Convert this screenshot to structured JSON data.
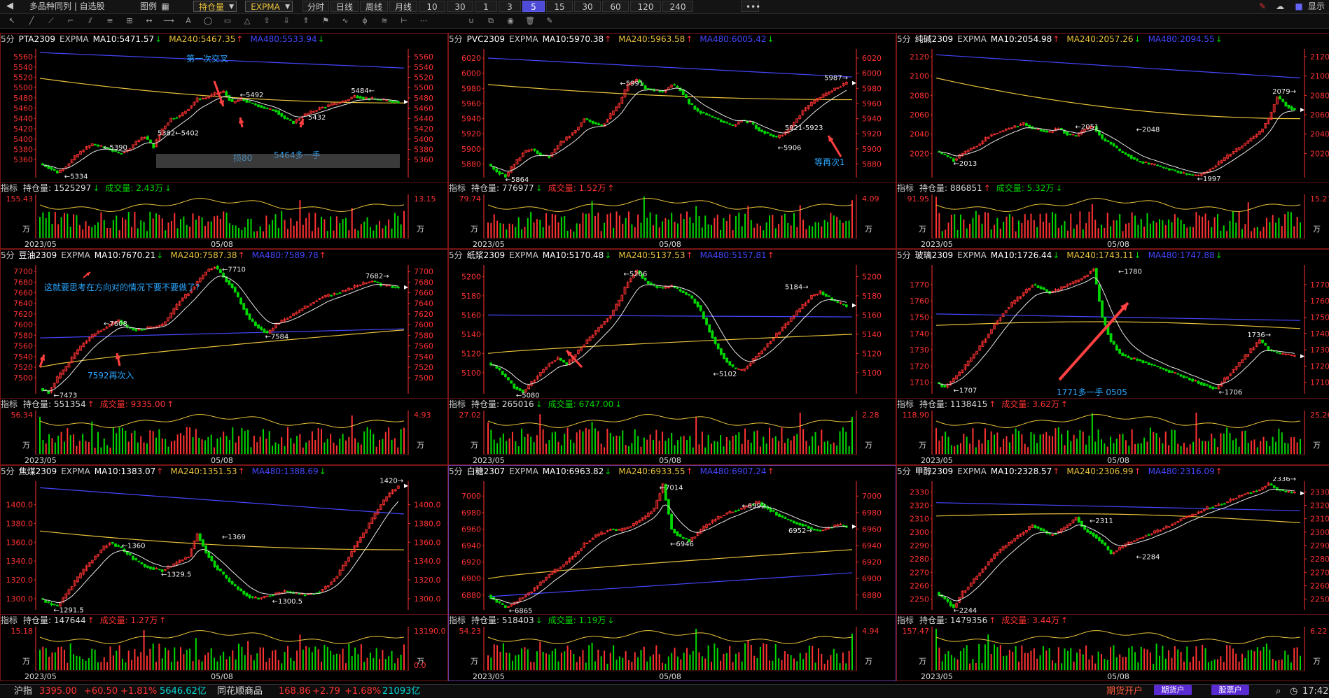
{
  "colors": {
    "up": "#ff3232",
    "down": "#00d700",
    "ma10": "#e8e8e8",
    "ma240": "#e8c23a",
    "ma480": "#4646ff",
    "volLine": "#e8c23a",
    "axis": "#ff3232"
  },
  "toolbar": {
    "back_icon": "back-icon",
    "title": "多品种同列 | 自选股",
    "legend_label": "图例",
    "position_select": "持仓量",
    "indicator_select": "EXPMA",
    "periods": [
      "分时",
      "日线",
      "周线",
      "月线",
      "10秒",
      "30秒",
      "1分",
      "3分",
      "5分",
      "15分",
      "30分",
      "60分",
      "120分",
      "240分"
    ],
    "active_period": "5分",
    "more_label": "•••",
    "right_label": "显示"
  },
  "panels": [
    {
      "id": "pta",
      "header": {
        "period": "5分",
        "name": "PTA2309",
        "ind": "EXPMA",
        "ma10": "MA10:5471.57",
        "ma10_dir": "↓",
        "ma240": "MA240:5467.35",
        "ma240_dir": "↑",
        "ma480": "MA480:5533.94",
        "ma480_dir": "↓"
      },
      "yTicks": [
        "5560",
        "5540",
        "5520",
        "5500",
        "5480",
        "5460",
        "5440",
        "5420",
        "5400",
        "5380",
        "5360"
      ],
      "yMin": 5325,
      "yMax": 5575,
      "ma480": [
        5568,
        5538
      ],
      "ma240": [
        5518,
        5470
      ],
      "ma240Shape": "flat",
      "priceMarks": [
        {
          "label": "←5334",
          "t": 0.06,
          "v": 5334
        },
        {
          "label": "←5390",
          "t": 0.17,
          "v": 5390
        },
        {
          "label": "5382←5402",
          "t": 0.32,
          "v": 5402
        },
        {
          "label": "←5492",
          "t": 0.55,
          "v": 5492
        },
        {
          "label": "5432",
          "t": 0.74,
          "v": 5432
        },
        {
          "label": "5484←",
          "t": 0.86,
          "v": 5484
        }
      ],
      "path": [
        5352,
        5345,
        5335,
        5348,
        5365,
        5380,
        5390,
        5385,
        5380,
        5372,
        5378,
        5395,
        5405,
        5385,
        5420,
        5440,
        5445,
        5460,
        5478,
        5480,
        5488,
        5492,
        5470,
        5478,
        5470,
        5465,
        5458,
        5455,
        5440,
        5432,
        5445,
        5452,
        5460,
        5465,
        5470,
        5475,
        5484,
        5480,
        5478,
        5476,
        5474,
        5472
      ],
      "annotations": [
        "第一次交叉",
        "损80",
        "5464多一手"
      ],
      "sub": {
        "label": "指标",
        "oi": "持仓量: 1525297",
        "oi_dir": "↓",
        "vol": "成交量: 2.43万",
        "vol_dir": "↓",
        "vol_color": "down",
        "left_top": "155.43",
        "right_top": "13.15",
        "unit": "万",
        "x1": "2023/05",
        "x2": "05/08"
      }
    },
    {
      "id": "pvc",
      "header": {
        "period": "5分",
        "name": "PVC2309",
        "ind": "EXPMA",
        "ma10": "MA10:5970.38",
        "ma10_dir": "↑",
        "ma240": "MA240:5963.58",
        "ma240_dir": "↑",
        "ma480": "MA480:6005.42",
        "ma480_dir": "↓"
      },
      "yTicks": [
        "6020",
        "6000",
        "5980",
        "5960",
        "5940",
        "5920",
        "5900",
        "5880"
      ],
      "yMin": 5862,
      "yMax": 6032,
      "ma480": [
        6020,
        5995
      ],
      "ma240": [
        5985,
        5965
      ],
      "ma240Shape": "flat",
      "priceMarks": [
        {
          "label": "←5864",
          "t": 0.04,
          "v": 5864
        },
        {
          "label": "←5991",
          "t": 0.36,
          "v": 5991
        },
        {
          "label": "5921-5923",
          "t": 0.82,
          "v": 5921
        },
        {
          "label": "←5906",
          "t": 0.8,
          "v": 5906
        },
        {
          "label": "5987→",
          "t": 0.93,
          "v": 5987
        }
      ],
      "path": [
        5880,
        5870,
        5864,
        5880,
        5895,
        5900,
        5892,
        5890,
        5905,
        5915,
        5925,
        5940,
        5935,
        5930,
        5945,
        5960,
        5985,
        5991,
        5980,
        5978,
        5975,
        5985,
        5978,
        5960,
        5950,
        5945,
        5940,
        5935,
        5930,
        5938,
        5935,
        5925,
        5920,
        5915,
        5921,
        5935,
        5950,
        5960,
        5968,
        5975,
        5982,
        5987
      ],
      "annotations": [
        "等再次1"
      ],
      "sub": {
        "label": "指标",
        "oi": "持仓量: 776977",
        "oi_dir": "↓",
        "vol": "成交量: 1.52万",
        "vol_dir": "↑",
        "vol_color": "up",
        "left_top": "79.74",
        "right_top": "4.09",
        "unit": "万",
        "x1": "2023/05",
        "x2": "05/08"
      }
    },
    {
      "id": "chunjian",
      "header": {
        "period": "5分",
        "name": "纯碱2309",
        "ind": "EXPMA",
        "ma10": "MA10:2054.98",
        "ma10_dir": "↑",
        "ma240": "MA240:2057.26",
        "ma240_dir": "↓",
        "ma480": "MA480:2094.55",
        "ma480_dir": "↓"
      },
      "yTicks": [
        "2120",
        "2100",
        "2080",
        "2060",
        "2040",
        "2020"
      ],
      "yMin": 1995,
      "yMax": 2128,
      "ma480": [
        2122,
        2098
      ],
      "ma240": [
        2098,
        2056
      ],
      "ma240Shape": "flat",
      "priceMarks": [
        {
          "label": "←2013",
          "t": 0.04,
          "v": 2013
        },
        {
          "label": "←2051",
          "t": 0.38,
          "v": 2051
        },
        {
          "label": "←2048",
          "t": 0.55,
          "v": 2048
        },
        {
          "label": "←1997",
          "t": 0.72,
          "v": 1997
        },
        {
          "label": "2079→",
          "t": 0.93,
          "v": 2079
        }
      ],
      "path": [
        2022,
        2018,
        2013,
        2020,
        2025,
        2030,
        2038,
        2042,
        2045,
        2048,
        2051,
        2046,
        2044,
        2042,
        2046,
        2040,
        2038,
        2045,
        2048,
        2035,
        2030,
        2022,
        2018,
        2012,
        2010,
        2008,
        2005,
        2003,
        2000,
        1998,
        1997,
        2002,
        2008,
        2015,
        2022,
        2028,
        2035,
        2042,
        2055,
        2079,
        2070,
        2065
      ],
      "annotations": [],
      "sub": {
        "label": "指标",
        "oi": "持仓量: 886851",
        "oi_dir": "↑",
        "vol": "成交量: 5.32万",
        "vol_dir": "↓",
        "vol_color": "down",
        "left_top": "91.95",
        "right_top": "15.27",
        "unit": "万",
        "x1": "2023/05",
        "x2": "05/08"
      }
    },
    {
      "id": "douyou",
      "header": {
        "period": "5分",
        "name": "豆油2309",
        "ind": "EXPMA",
        "ma10": "MA10:7670.21",
        "ma10_dir": "↓",
        "ma240": "MA240:7587.38",
        "ma240_dir": "↑",
        "ma480": "MA480:7589.78",
        "ma480_dir": "↑"
      },
      "yTicks": [
        "7700",
        "7680",
        "7660",
        "7640",
        "7620",
        "7600",
        "7580",
        "7560",
        "7540",
        "7520",
        "7500"
      ],
      "yMin": 7470,
      "yMax": 7712,
      "ma480": [
        7575,
        7592
      ],
      "ma240": [
        7520,
        7590
      ],
      "ma240Shape": "rise",
      "priceMarks": [
        {
          "label": "←7473",
          "t": 0.03,
          "v": 7473
        },
        {
          "label": "←7608",
          "t": 0.17,
          "v": 7608
        },
        {
          "label": "←7710",
          "t": 0.5,
          "v": 7710
        },
        {
          "label": "←7584",
          "t": 0.62,
          "v": 7584
        },
        {
          "label": "7682→",
          "t": 0.9,
          "v": 7682
        }
      ],
      "path": [
        7480,
        7473,
        7500,
        7520,
        7545,
        7565,
        7580,
        7590,
        7600,
        7608,
        7595,
        7590,
        7592,
        7595,
        7600,
        7620,
        7645,
        7660,
        7680,
        7700,
        7710,
        7690,
        7670,
        7640,
        7610,
        7595,
        7584,
        7600,
        7610,
        7620,
        7630,
        7640,
        7650,
        7655,
        7660,
        7665,
        7672,
        7678,
        7682,
        7675,
        7672,
        7670
      ],
      "annotations": [
        "这就要思考在方向对的情况下要不要做了?",
        "7592再次入"
      ],
      "sub": {
        "label": "指标",
        "oi": "持仓量: 551354",
        "oi_dir": "↑",
        "vol": "成交量: 9335.00",
        "vol_dir": "↑",
        "vol_color": "up",
        "left_top": "56.34",
        "right_top": "4.93",
        "unit": "万",
        "x1": "2023/05",
        "x2": "05/08"
      }
    },
    {
      "id": "zhijiang",
      "header": {
        "period": "5分",
        "name": "纸浆2309",
        "ind": "EXPMA",
        "ma10": "MA10:5170.48",
        "ma10_dir": "↓",
        "ma240": "MA240:5137.53",
        "ma240_dir": "↑",
        "ma480": "MA480:5157.81",
        "ma480_dir": "↑"
      },
      "yTicks": [
        "5200",
        "5180",
        "5160",
        "5140",
        "5120",
        "5100"
      ],
      "yMin": 5078,
      "yMax": 5212,
      "ma480": [
        5160,
        5158
      ],
      "ma240": [
        5120,
        5140
      ],
      "ma240Shape": "rise",
      "priceMarks": [
        {
          "label": "←5080",
          "t": 0.07,
          "v": 5080
        },
        {
          "label": "←5206",
          "t": 0.37,
          "v": 5206
        },
        {
          "label": "←5102",
          "t": 0.62,
          "v": 5102
        },
        {
          "label": "5184→",
          "t": 0.82,
          "v": 5184
        }
      ],
      "path": [
        5110,
        5105,
        5095,
        5085,
        5080,
        5090,
        5100,
        5110,
        5115,
        5108,
        5120,
        5130,
        5140,
        5150,
        5160,
        5175,
        5195,
        5206,
        5195,
        5190,
        5188,
        5190,
        5185,
        5180,
        5170,
        5150,
        5130,
        5115,
        5105,
        5102,
        5110,
        5120,
        5130,
        5140,
        5150,
        5160,
        5170,
        5180,
        5184,
        5178,
        5172,
        5170
      ],
      "annotations": [],
      "sub": {
        "label": "指标",
        "oi": "持仓量: 265016",
        "oi_dir": "↓",
        "vol": "成交量: 6747.00",
        "vol_dir": "↓",
        "vol_color": "down",
        "left_top": "27.02",
        "right_top": "2.28",
        "unit": "万",
        "x1": "2023/05",
        "x2": "05/08"
      }
    },
    {
      "id": "boli",
      "header": {
        "period": "5分",
        "name": "玻璃2309",
        "ind": "EXPMA",
        "ma10": "MA10:1726.44",
        "ma10_dir": "↓",
        "ma240": "MA240:1743.11",
        "ma240_dir": "↓",
        "ma480": "MA480:1747.88",
        "ma480_dir": "↓"
      },
      "yTicks": [
        "1770",
        "1760",
        "1750",
        "1740",
        "1730",
        "1720",
        "1710"
      ],
      "yMin": 1703,
      "yMax": 1782,
      "ma480": [
        1752,
        1748
      ],
      "ma240": [
        1745,
        1743
      ],
      "ma240Shape": "hump",
      "priceMarks": [
        {
          "label": "←1707",
          "t": 0.04,
          "v": 1707
        },
        {
          "label": "←1780",
          "t": 0.5,
          "v": 1780
        },
        {
          "label": "1736→",
          "t": 0.86,
          "v": 1736
        },
        {
          "label": "←1706",
          "t": 0.78,
          "v": 1706
        }
      ],
      "path": [
        1710,
        1707,
        1712,
        1718,
        1725,
        1732,
        1740,
        1748,
        1755,
        1760,
        1765,
        1770,
        1768,
        1765,
        1767,
        1770,
        1772,
        1775,
        1780,
        1750,
        1735,
        1728,
        1725,
        1724,
        1722,
        1720,
        1718,
        1716,
        1714,
        1712,
        1710,
        1708,
        1706,
        1712,
        1718,
        1724,
        1730,
        1736,
        1730,
        1728,
        1727,
        1726
      ],
      "annotations": [
        "1771多一手 0505"
      ],
      "sub": {
        "label": "指标",
        "oi": "持仓量: 1138415",
        "oi_dir": "↑",
        "vol": "成交量: 3.62万",
        "vol_dir": "↑",
        "vol_color": "up",
        "left_top": "118.90",
        "right_top": "25.26",
        "unit": "万",
        "x1": "2023/05",
        "x2": "05/08"
      }
    },
    {
      "id": "jiaomei",
      "header": {
        "period": "5分",
        "name": "焦煤2309",
        "ind": "EXPMA",
        "ma10": "MA10:1383.07",
        "ma10_dir": "↑",
        "ma240": "MA240:1351.53",
        "ma240_dir": "↑",
        "ma480": "MA480:1388.69",
        "ma480_dir": "↓"
      },
      "yTicks": [
        "1400.0",
        "1380.0",
        "1360.0",
        "1340.0",
        "1320.0",
        "1300.0"
      ],
      "yMin": 1288,
      "yMax": 1425,
      "ma480": [
        1418,
        1390
      ],
      "ma240": [
        1372,
        1352
      ],
      "ma240Shape": "flat",
      "priceMarks": [
        {
          "label": "←1291.5",
          "t": 0.03,
          "v": 1291.5
        },
        {
          "label": "←1360",
          "t": 0.22,
          "v": 1360
        },
        {
          "label": "←1329.5",
          "t": 0.33,
          "v": 1329.5
        },
        {
          "label": "←1369",
          "t": 0.5,
          "v": 1369
        },
        {
          "label": "←1300.5",
          "t": 0.64,
          "v": 1300.5
        },
        {
          "label": "1420→",
          "t": 0.94,
          "v": 1420
        }
      ],
      "path": [
        1300,
        1295,
        1292,
        1305,
        1318,
        1330,
        1342,
        1352,
        1360,
        1355,
        1348,
        1340,
        1335,
        1332,
        1330,
        1335,
        1340,
        1345,
        1369,
        1350,
        1335,
        1325,
        1315,
        1308,
        1302,
        1300,
        1303,
        1305,
        1308,
        1306,
        1304,
        1305,
        1308,
        1315,
        1325,
        1340,
        1355,
        1370,
        1385,
        1400,
        1412,
        1420
      ],
      "annotations": [],
      "sub": {
        "label": "指标",
        "oi": "持仓量: 147644",
        "oi_dir": "↑",
        "vol": "成交量: 1.27万",
        "vol_dir": "↑",
        "vol_color": "up",
        "left_top": "15.18",
        "right_top": "13190.0",
        "right_bottom": "0.0",
        "unit": "万",
        "x1": "2023/05",
        "x2": "05/08"
      }
    },
    {
      "id": "baitang",
      "header": {
        "period": "5分",
        "name": "白糖2307",
        "ind": "EXPMA",
        "ma10": "MA10:6963.82",
        "ma10_dir": "↓",
        "ma240": "MA240:6933.55",
        "ma240_dir": "↑",
        "ma480": "MA480:6907.24",
        "ma480_dir": "↑"
      },
      "yTicks": [
        "7000",
        "6980",
        "6960",
        "6940",
        "6920",
        "6900",
        "6880"
      ],
      "yMin": 6862,
      "yMax": 7018,
      "ma480": [
        6878,
        6907
      ],
      "ma240": [
        6900,
        6935
      ],
      "ma240Shape": "rise",
      "priceMarks": [
        {
          "label": "←6865",
          "t": 0.05,
          "v": 6865
        },
        {
          "label": "←7014",
          "t": 0.47,
          "v": 7014
        },
        {
          "label": "←6946",
          "t": 0.5,
          "v": 6946
        },
        {
          "label": "←6992",
          "t": 0.7,
          "v": 6992
        },
        {
          "label": "6952→",
          "t": 0.83,
          "v": 6952
        }
      ],
      "path": [
        6880,
        6872,
        6865,
        6870,
        6878,
        6885,
        6895,
        6905,
        6912,
        6920,
        6930,
        6942,
        6950,
        6955,
        6960,
        6958,
        6962,
        6968,
        6975,
        6985,
        7014,
        6960,
        6950,
        6946,
        6955,
        6965,
        6972,
        6978,
        6982,
        6985,
        6990,
        6992,
        6985,
        6978,
        6972,
        6968,
        6965,
        6960,
        6958,
        6962,
        6965,
        6963
      ],
      "annotations": [],
      "sub": {
        "label": "指标",
        "oi": "持仓量: 518403",
        "oi_dir": "↓",
        "vol": "成交量: 1.19万",
        "vol_dir": "↓",
        "vol_color": "down",
        "left_top": "54.23",
        "right_top": "4.94",
        "unit": "万",
        "x1": "2023/05",
        "x2": "05/08"
      }
    },
    {
      "id": "jiachun",
      "header": {
        "period": "5分",
        "name": "甲醇2309",
        "ind": "EXPMA",
        "ma10": "MA10:2328.57",
        "ma10_dir": "↑",
        "ma240": "MA240:2306.99",
        "ma240_dir": "↑",
        "ma480": "MA480:2316.09",
        "ma480_dir": "↑"
      },
      "yTicks": [
        "2330",
        "2320",
        "2310",
        "2300",
        "2290",
        "2280",
        "2270",
        "2260",
        "2250"
      ],
      "yMin": 2242,
      "yMax": 2338,
      "ma480": [
        2322,
        2316
      ],
      "ma240": [
        2312,
        2307
      ],
      "ma240Shape": "hump",
      "priceMarks": [
        {
          "label": "←2244",
          "t": 0.04,
          "v": 2244
        },
        {
          "label": "←2311",
          "t": 0.42,
          "v": 2311
        },
        {
          "label": "←2284",
          "t": 0.55,
          "v": 2284
        },
        {
          "label": "2336→",
          "t": 0.93,
          "v": 2336
        }
      ],
      "path": [
        2255,
        2250,
        2244,
        2255,
        2262,
        2270,
        2278,
        2285,
        2290,
        2295,
        2300,
        2305,
        2302,
        2298,
        2300,
        2305,
        2311,
        2302,
        2298,
        2292,
        2284,
        2288,
        2292,
        2295,
        2298,
        2300,
        2303,
        2306,
        2310,
        2312,
        2315,
        2318,
        2320,
        2322,
        2325,
        2328,
        2330,
        2332,
        2336,
        2332,
        2330,
        2329
      ],
      "annotations": [],
      "sub": {
        "label": "指标",
        "oi": "持仓量: 1479356",
        "oi_dir": "↑",
        "vol": "成交量: 3.44万",
        "vol_dir": "↑",
        "vol_color": "up",
        "left_top": "157.47",
        "right_top": "6.22",
        "unit": "万",
        "x1": "2023/05",
        "x2": "05/08"
      }
    }
  ],
  "status": {
    "index_name": "沪指",
    "index_val": "3395.00",
    "index_chg": "+60.50",
    "index_pct": "+1.81%",
    "index_amt": "5646.62亿",
    "ths_name": "同花顺商品",
    "ths_val": "168.86",
    "ths_chg": "+2.79",
    "ths_pct": "+1.68%",
    "ths_amt": "21093亿",
    "futures_open": "期货开户",
    "futures_btn": "期货户",
    "stock_btn": "股票户",
    "time": "17:42"
  }
}
